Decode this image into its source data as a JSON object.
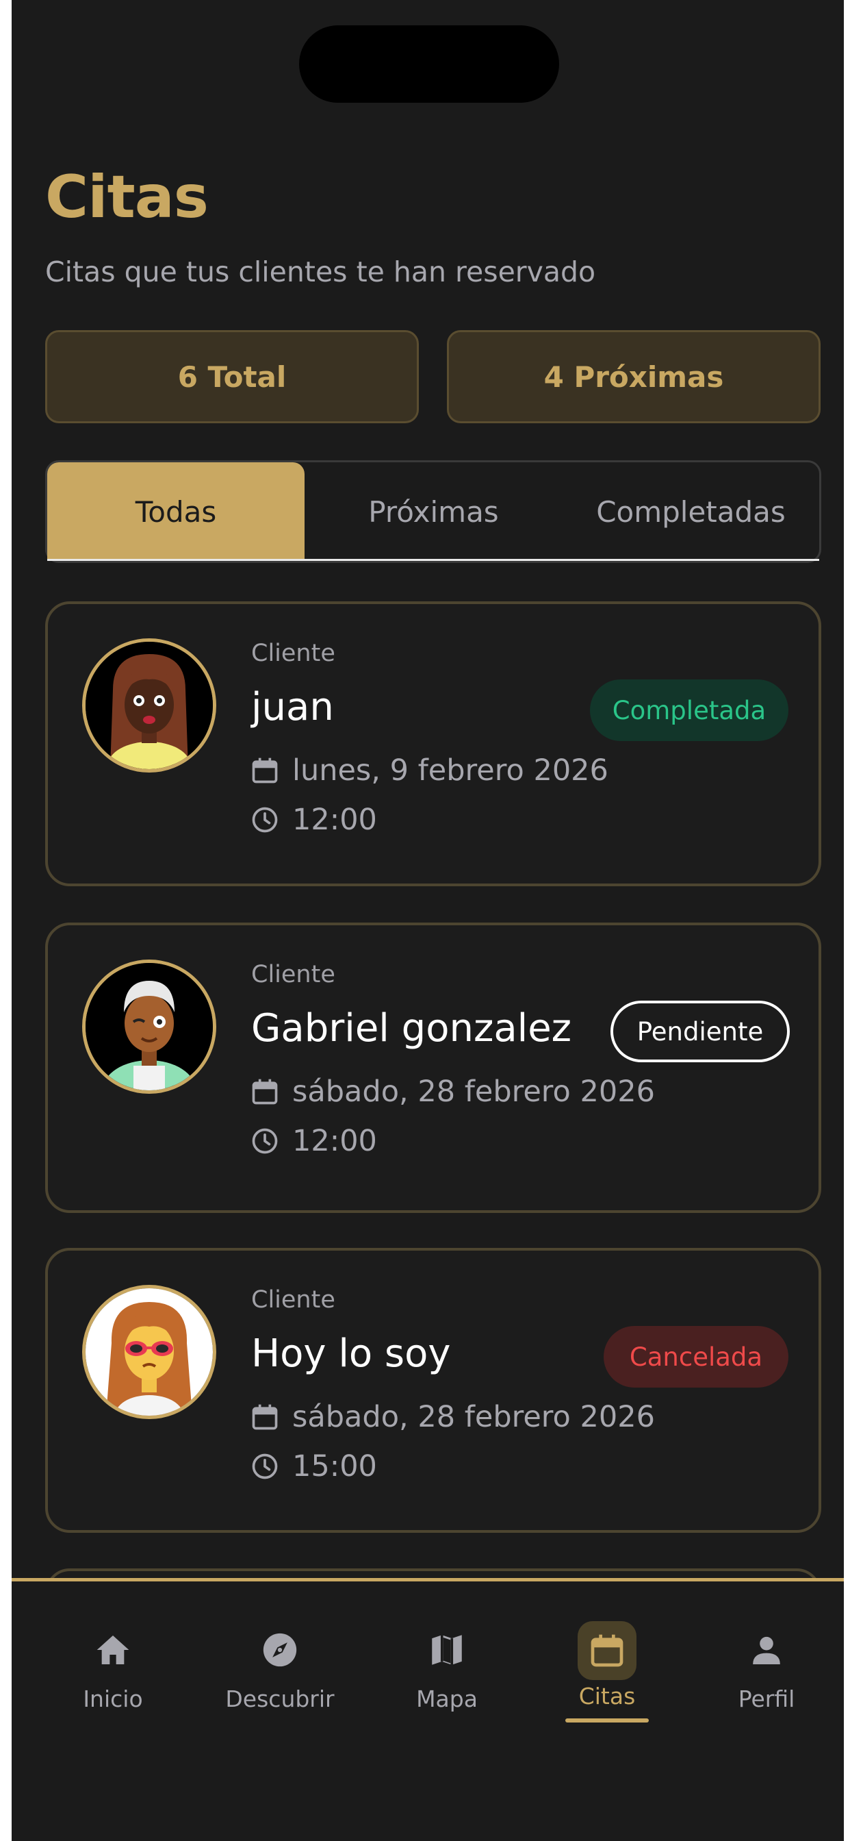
{
  "page": {
    "title": "Citas",
    "subtitle": "Citas que tus clientes te han reservado"
  },
  "stats": {
    "total": "6 Total",
    "upcoming": "4 Próximas"
  },
  "tabs": [
    {
      "label": "Todas",
      "active": true
    },
    {
      "label": "Próximas",
      "active": false
    },
    {
      "label": "Completadas",
      "active": false
    }
  ],
  "appointments": [
    {
      "label": "Cliente",
      "name": "juan",
      "status": "Completada",
      "date": "lunes, 9 febrero 2026",
      "time": "12:00"
    },
    {
      "label": "Cliente",
      "name": "Gabriel gonzalez",
      "status": "Pendiente",
      "date": "sábado, 28 febrero 2026",
      "time": "12:00"
    },
    {
      "label": "Cliente",
      "name": "Hoy lo soy",
      "status": "Cancelada",
      "date": "sábado, 28 febrero 2026",
      "time": "15:00"
    }
  ],
  "nav": [
    {
      "label": "Inicio",
      "icon": "home-icon",
      "active": false
    },
    {
      "label": "Descubrir",
      "icon": "compass-icon",
      "active": false
    },
    {
      "label": "Mapa",
      "icon": "map-icon",
      "active": false
    },
    {
      "label": "Citas",
      "icon": "calendar-icon",
      "active": true
    },
    {
      "label": "Perfil",
      "icon": "person-icon",
      "active": false
    }
  ],
  "colors": {
    "accent": "#c9a862",
    "background": "#1b1b1b",
    "completed": "#2ac589",
    "cancelled": "#ef4a4a"
  }
}
